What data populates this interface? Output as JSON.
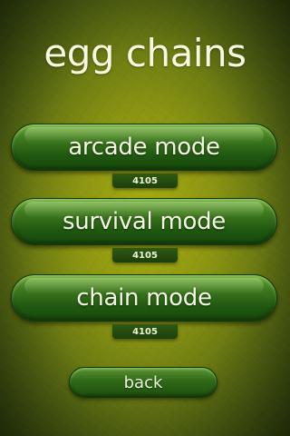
{
  "title": "egg chains",
  "menu": [
    {
      "label": "arcade mode",
      "score": "4105"
    },
    {
      "label": "survival mode",
      "score": "4105"
    },
    {
      "label": "chain mode",
      "score": "4105"
    }
  ],
  "back_label": "back",
  "colors": {
    "background": "#8a9412",
    "button_green": "#2f6a18",
    "text": "#f6f8e6"
  }
}
